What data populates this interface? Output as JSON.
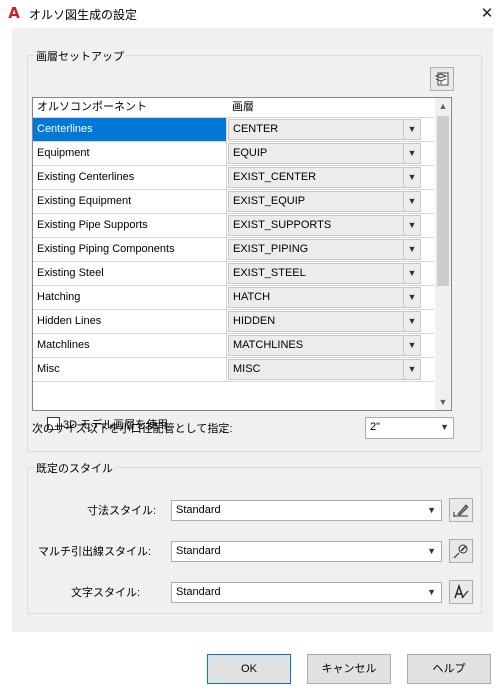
{
  "window": {
    "title": "オルソ図生成の設定",
    "close_glyph": "✕",
    "app_glyph": "A"
  },
  "layer_setup": {
    "group_title": "画層セットアップ",
    "column_headers": [
      "オルソコンポーネント",
      "画層"
    ],
    "rows": [
      {
        "component": "Centerlines",
        "layer": "CENTER",
        "selected": true
      },
      {
        "component": "Equipment",
        "layer": "EQUIP"
      },
      {
        "component": "Existing Centerlines",
        "layer": "EXIST_CENTER"
      },
      {
        "component": "Existing Equipment",
        "layer": "EXIST_EQUIP"
      },
      {
        "component": "Existing Pipe Supports",
        "layer": "EXIST_SUPPORTS"
      },
      {
        "component": "Existing Piping Components",
        "layer": "EXIST_PIPING"
      },
      {
        "component": "Existing Steel",
        "layer": "EXIST_STEEL"
      },
      {
        "component": "Hatching",
        "layer": "HATCH"
      },
      {
        "component": "Hidden Lines",
        "layer": "HIDDEN"
      },
      {
        "component": "Matchlines",
        "layer": "MATCHLINES"
      },
      {
        "component": "Misc",
        "layer": "MISC"
      }
    ],
    "use_3d_layers_label": "3D モデル画層を使用",
    "use_3d_layers_checked": false,
    "small_bore_label": "次のサイズ以下を小口径配管として指定:",
    "small_bore_value": "2\""
  },
  "default_styles": {
    "group_title": "既定のスタイル",
    "dimension_style_label": "寸法スタイル:",
    "dimension_style_value": "Standard",
    "multileader_style_label": "マルチ引出線スタイル:",
    "multileader_style_value": "Standard",
    "text_style_label": "文字スタイル:",
    "text_style_value": "Standard"
  },
  "buttons": {
    "ok": "OK",
    "cancel": "キャンセル",
    "help": "ヘルプ"
  },
  "colors": {
    "selection": "#0078d7",
    "app_icon": "#cc1f1f",
    "dialog_bg": "#f0f0f0"
  }
}
